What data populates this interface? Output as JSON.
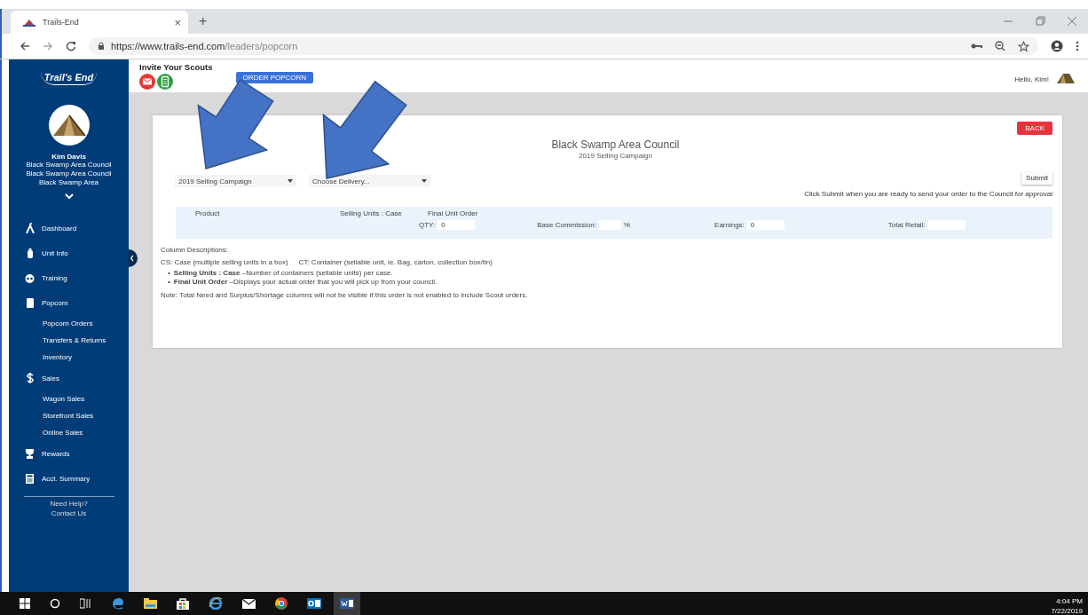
{
  "browser": {
    "tab_title": "Trails-End",
    "tab_close": "×",
    "new_tab": "+",
    "url_host": "https://www.trails-end.com",
    "url_path": "/leaders/popcorn"
  },
  "sidebar": {
    "logo": "Trail's End",
    "user_name": "Kim Davis",
    "user_lines": [
      "Black Swamp Area Council",
      "Black Swamp Area Council",
      "Black Swamp Area"
    ],
    "items": [
      {
        "label": "Dashboard",
        "kind": "dashboard"
      },
      {
        "label": "Unit Info",
        "kind": "unit"
      },
      {
        "label": "Training",
        "kind": "training"
      },
      {
        "label": "Popcorn",
        "kind": "popcorn",
        "children": [
          {
            "label": "Popcorn Orders"
          },
          {
            "label": "Transfers & Returns"
          },
          {
            "label": "Inventory"
          }
        ]
      },
      {
        "label": "Sales",
        "kind": "sales",
        "children": [
          {
            "label": "Wagon Sales"
          },
          {
            "label": "Storefront Sales"
          },
          {
            "label": "Online Sales"
          }
        ]
      },
      {
        "label": "Rewards",
        "kind": "rewards"
      },
      {
        "label": "Acct. Summary",
        "kind": "summary"
      }
    ],
    "footer": [
      "Need Help?",
      "Contact Us"
    ]
  },
  "header": {
    "invite": "Invite Your Scouts",
    "order_button": "ORDER POPCORN",
    "greeting": "Hello, Kim!"
  },
  "card": {
    "back_button": "BACK",
    "title": "Black Swamp Area Council",
    "subtitle": "2019 Selling Campaign",
    "selects": [
      {
        "value": "2019 Selling Campaign"
      },
      {
        "value": "Choose Delivery..."
      }
    ],
    "submit_button": "Submit",
    "submit_note": "Click Submit when you are ready to send your order to the Council for approval",
    "columns": [
      "Product",
      "Selling Units : Case",
      "Final Unit Order"
    ],
    "fields": [
      {
        "label": "QTY:",
        "value": "0"
      },
      {
        "label": "Base Commission:",
        "suffix": "%"
      },
      {
        "label": "Earnings:",
        "value": "0"
      },
      {
        "label": "Total Retail:"
      }
    ],
    "descriptions_heading": "Column Descriptions:",
    "abbreviations": [
      "CS: Case (multiple selling units in a box)",
      "CT: Container (sellable unit, ie. Bag, carton, collection box/tin)"
    ],
    "bullets": [
      {
        "marker": "•",
        "text": "**Selling Units : Case** –Number of containers (sellable units) per case."
      },
      {
        "marker": "•",
        "text": "**Final Unit Order** –Displays your actual order that you will pick up from your council."
      }
    ],
    "note": "Note: Total Need and Surplus/Shortage columns will not be visible if this order is not enabled to include Scout orders."
  },
  "taskbar": {
    "time": "4:04 PM",
    "date": "7/22/2019"
  }
}
